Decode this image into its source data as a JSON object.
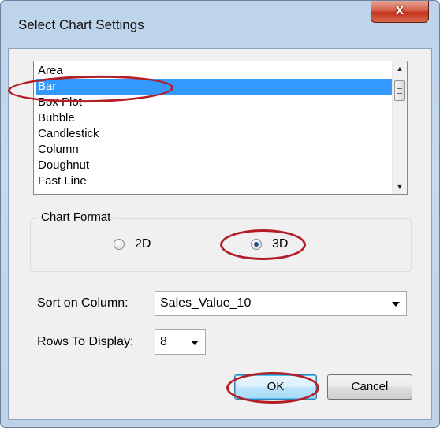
{
  "window": {
    "title": "Select Chart Settings",
    "close_symbol": "x"
  },
  "chart_types": {
    "items": [
      "Area",
      "Bar",
      "Box Plot",
      "Bubble",
      "Candlestick",
      "Column",
      "Doughnut",
      "Fast Line"
    ],
    "selected": "Bar"
  },
  "chart_format": {
    "legend": "Chart Format",
    "option_2d": "2D",
    "option_3d": "3D",
    "selected": "3D"
  },
  "sort": {
    "label": "Sort on Column:",
    "value": "Sales_Value_10"
  },
  "rows": {
    "label": "Rows To Display:",
    "value": "8"
  },
  "buttons": {
    "ok": "OK",
    "cancel": "Cancel"
  },
  "colors": {
    "selection": "#3399ff",
    "annotation": "#b31e27",
    "close_button": "#c2321a"
  },
  "icons": {
    "scroll_up": "▲",
    "scroll_down": "▼"
  }
}
